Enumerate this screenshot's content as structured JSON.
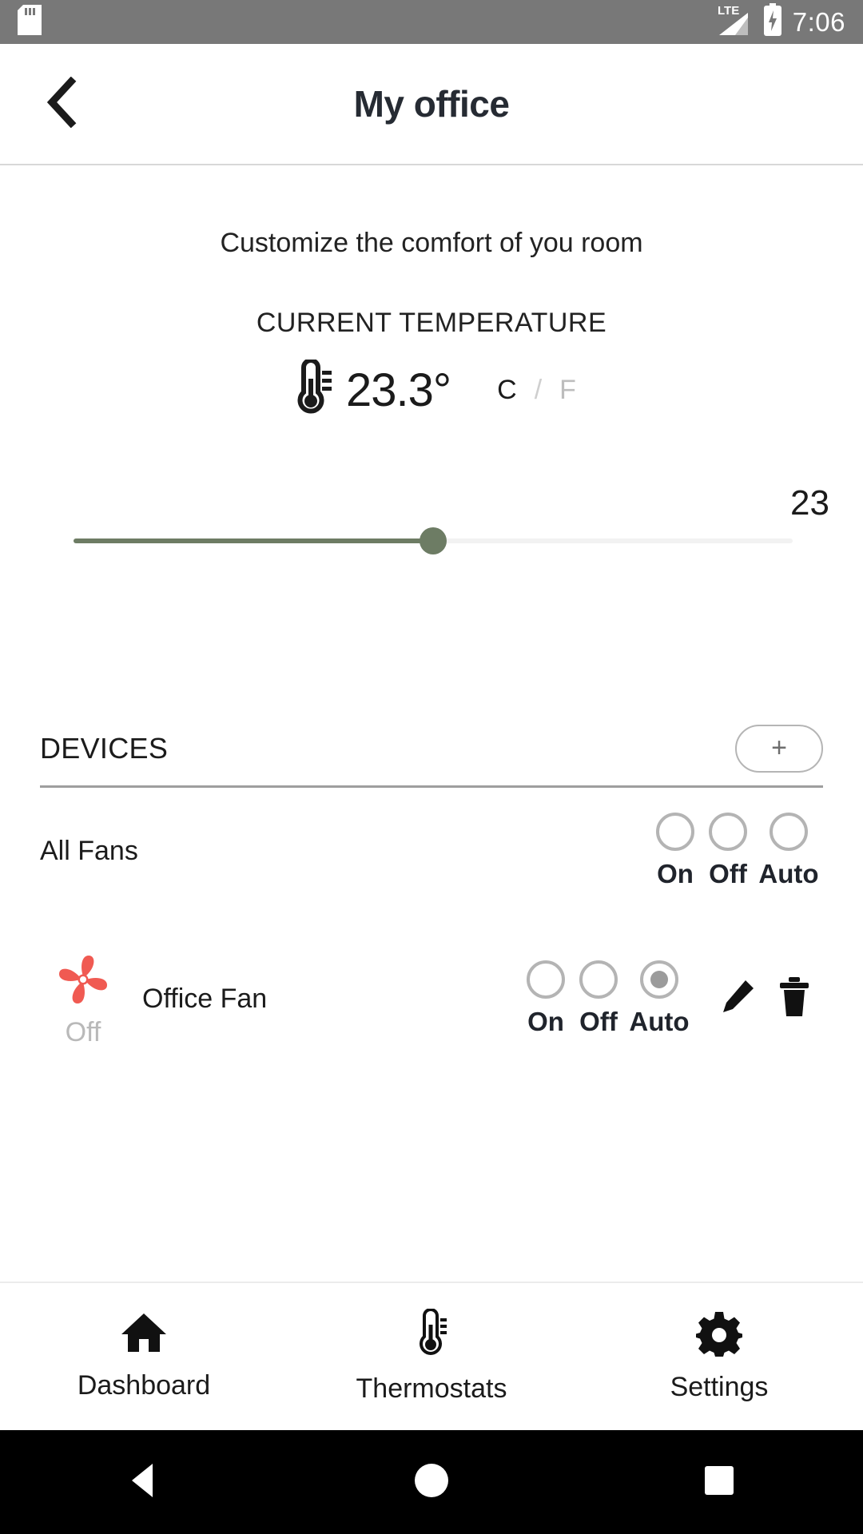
{
  "statusbar": {
    "sd_icon": "sd-card-icon",
    "network_label": "LTE",
    "signal_icon": "signal-bars-icon",
    "battery_icon": "battery-charging-icon",
    "time": "7:06",
    "background": "#787878"
  },
  "titlebar": {
    "back_icon": "chevron-left-icon",
    "title": "My office"
  },
  "thermostat": {
    "subtitle": "Customize the comfort of you room",
    "current_temp_label": "CURRENT TEMPERATURE",
    "thermometer_icon": "thermometer-icon",
    "temperature": "23.3°",
    "unit_celsius": "C",
    "unit_separator": "/",
    "unit_fahrenheit": "F",
    "active_unit": "C",
    "slider": {
      "value": "23",
      "min": 0,
      "max": 46,
      "fill_percent": 50,
      "track_color": "#6d7c64",
      "track_bg_color": "#f2f2f2"
    }
  },
  "devices": {
    "section_label": "DEVICES",
    "add_button_label": "+",
    "rows": [
      {
        "name": "All Fans",
        "has_device_icon": false,
        "state": "",
        "selected": null,
        "options": [
          "On",
          "Off",
          "Auto"
        ],
        "has_actions": false
      },
      {
        "name": "Office Fan",
        "has_device_icon": true,
        "device_icon": "fan-icon",
        "device_icon_color": "#f05a52",
        "state": "Off",
        "selected": "Auto",
        "options": [
          "On",
          "Off",
          "Auto"
        ],
        "has_actions": true,
        "edit_icon": "pencil-icon",
        "delete_icon": "trash-icon"
      }
    ]
  },
  "bottomnav": {
    "items": [
      {
        "label": "Dashboard",
        "icon": "home-icon"
      },
      {
        "label": "Thermostats",
        "icon": "thermometer-icon"
      },
      {
        "label": "Settings",
        "icon": "gear-icon"
      }
    ]
  },
  "sysnav": {
    "back": "back-triangle-icon",
    "home": "home-circle-icon",
    "recents": "recents-square-icon"
  }
}
